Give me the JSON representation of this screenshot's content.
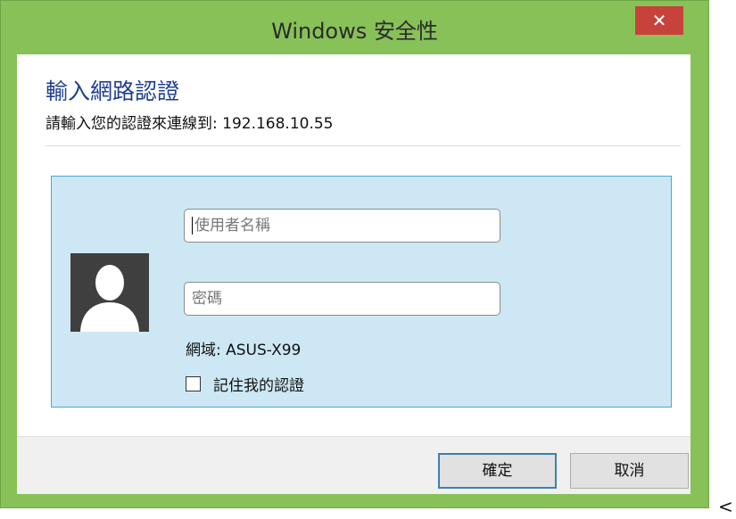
{
  "window": {
    "title": "Windows 安全性",
    "close_label": "✕"
  },
  "dialog": {
    "heading": "輸入網路認證",
    "subtext": "請輸入您的認證來連線到: 192.168.10.55"
  },
  "form": {
    "username_placeholder": "使用者名稱",
    "password_placeholder": "密碼",
    "domain_text": "網域: ASUS-X99",
    "remember_label": "記住我的認證",
    "remember_checked": false
  },
  "buttons": {
    "ok_label": "確定",
    "cancel_label": "取消"
  },
  "stray_char": "<",
  "colors": {
    "frame": "#87c158",
    "close": "#c7423b",
    "heading": "#1f3e92",
    "panel": "#cde8f4"
  },
  "icons": {
    "avatar": "user-silhouette-icon",
    "close": "close-icon"
  }
}
